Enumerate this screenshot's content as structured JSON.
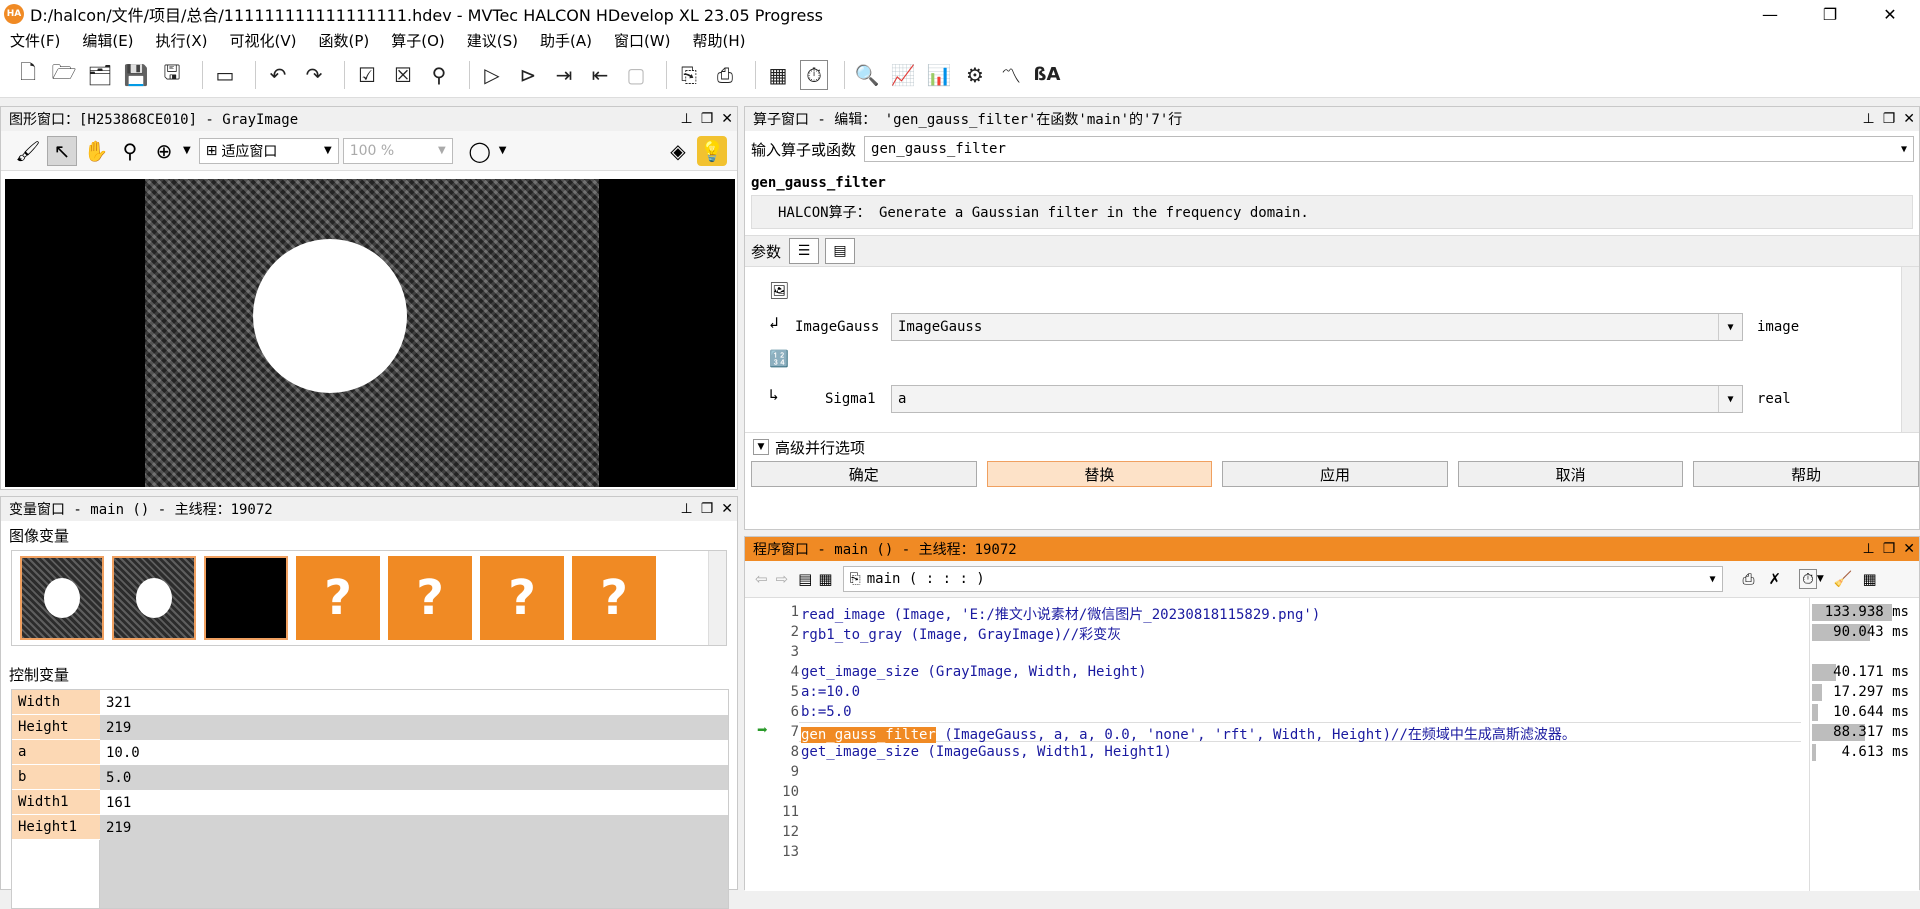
{
  "window": {
    "app_icon": "HA",
    "title": "D:/halcon/文件/项目/总合/111111111111111111.hdev - MVTec HALCON HDevelop XL 23.05 Progress",
    "minimize": "—",
    "restore": "❐",
    "close": "✕"
  },
  "menu": [
    "文件(F)",
    "编辑(E)",
    "执行(X)",
    "可视化(V)",
    "函数(P)",
    "算子(O)",
    "建议(S)",
    "助手(A)",
    "窗口(W)",
    "帮助(H)"
  ],
  "graphics": {
    "header": "图形窗口：[H253868CE010] - GrayImage",
    "zoom_mode": "适应窗口",
    "zoom_percent": "100 %"
  },
  "variables": {
    "header": "变量窗口 - main () - 主线程：19072",
    "image_section": "图像变量",
    "thumb_placeholder": "?",
    "control_section": "控制变量",
    "control_vars": [
      {
        "name": "Width",
        "value": "321"
      },
      {
        "name": "Height",
        "value": "219"
      },
      {
        "name": "a",
        "value": "10.0"
      },
      {
        "name": "b",
        "value": "5.0"
      },
      {
        "name": "Width1",
        "value": "161"
      },
      {
        "name": "Height1",
        "value": "219"
      }
    ]
  },
  "operator": {
    "header": "算子窗口 - 编辑： 'gen_gauss_filter'在函数'main'的'7'行",
    "input_label": "输入算子或函数",
    "input_value": "gen_gauss_filter",
    "name": "gen_gauss_filter",
    "description": "HALCON算子： Generate a Gaussian filter in the frequency domain.",
    "params_label": "参数",
    "params": [
      {
        "name": "ImageGauss",
        "value": "ImageGauss",
        "type": "image"
      },
      {
        "name": "Sigma1",
        "value": "a",
        "type": "real"
      }
    ],
    "advanced": "高级并行选项",
    "buttons": {
      "ok": "确定",
      "replace": "替换",
      "apply": "应用",
      "cancel": "取消",
      "help": "帮助"
    }
  },
  "program": {
    "header": "程序窗口 - main () - 主线程：19072",
    "procedure": "main ( : : : )",
    "lines": [
      {
        "n": "1",
        "code": "read_image (Image, 'E:/推文小说素材/微信图片_20230818115829.png')",
        "time": "133.938 ms"
      },
      {
        "n": "2",
        "code": "rgb1_to_gray (Image, GrayImage)//彩变灰",
        "time": "90.043 ms"
      },
      {
        "n": "3",
        "code": "",
        "time": ""
      },
      {
        "n": "4",
        "code": "get_image_size (GrayImage, Width, Height)",
        "time": "40.171 ms"
      },
      {
        "n": "5",
        "code": "a:=10.0",
        "time": "17.297 ms"
      },
      {
        "n": "6",
        "code": "b:=5.0",
        "time": "10.644 ms"
      },
      {
        "n": "7",
        "code_kw": "gen_gauss_filter",
        "code_rest": " (ImageGauss, a, a, 0.0, 'none', 'rft', Width, Height)//在频域中生成高斯滤波器。",
        "time": "88.317 ms"
      },
      {
        "n": "8",
        "code": "get_image_size (ImageGauss, Width1, Height1)",
        "time": "4.613 ms"
      },
      {
        "n": "9",
        "code": "",
        "time": ""
      },
      {
        "n": "10",
        "code": "",
        "time": ""
      },
      {
        "n": "11",
        "code": "",
        "time": ""
      },
      {
        "n": "12",
        "code": "",
        "time": ""
      },
      {
        "n": "13",
        "code": "",
        "time": ""
      }
    ],
    "timing_fractions": [
      1.0,
      0.72,
      0,
      0.3,
      0.13,
      0.08,
      0.66,
      0.03
    ]
  },
  "colors": {
    "accent_orange": "#f08a24",
    "code_blue": "#1a1aa0",
    "var_name_bg": "#fcd8b4"
  }
}
